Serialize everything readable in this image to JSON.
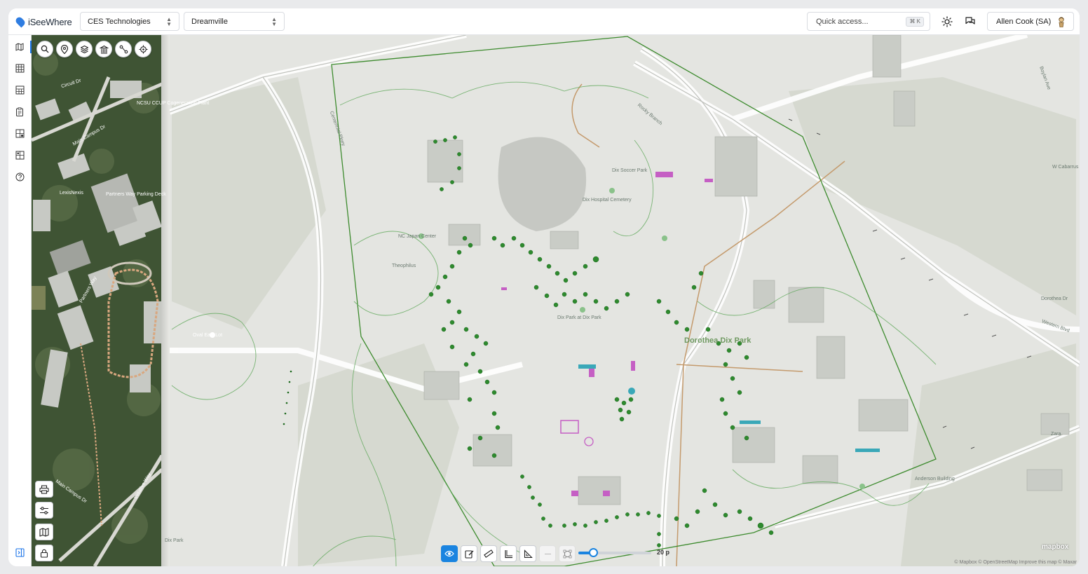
{
  "app": {
    "logo_text": "iSeeWhere",
    "brand_color": "#2f7de1"
  },
  "header": {
    "company_select": "CES Technologies",
    "site_select": "Dreamville",
    "quick_access_placeholder": "Quick access...",
    "quick_access_shortcut": "⌘ K",
    "theme_icon": "sun-icon",
    "chat_icon": "chat-icon",
    "user_name": "Allen Cook (SA)"
  },
  "sidebar": {
    "items": [
      {
        "icon": "map-icon",
        "active": true
      },
      {
        "icon": "grid-map-icon"
      },
      {
        "icon": "table-icon"
      },
      {
        "icon": "clipboard-icon"
      },
      {
        "icon": "layers-grid-icon"
      },
      {
        "icon": "grid-settings-icon"
      },
      {
        "icon": "help-icon"
      }
    ],
    "collapse_icon": "sidebar-toggle-icon"
  },
  "map": {
    "satellite_labels": [
      "Circuit Dr",
      "NCSU CCUP Cogeneration Plant",
      "Main Campus Dr",
      "LexisNexis",
      "Partners Way Parking Deck",
      "Partners Way",
      "Dix Park",
      "Main Campus Dr",
      "Initiative Way"
    ],
    "street_labels": [
      "Dix Soccer Park",
      "Dix Hospital Cemetery",
      "NC Japan Center",
      "Theophilus",
      "Dix Park at Dix Park",
      "Dorothea Dix Park",
      "Oval East Lot",
      "Centennial Pkwy",
      "Rocky Branch",
      "W Cabarrus",
      "Western Blvd",
      "Dorothea Dr",
      "Boylan Ave",
      "Anderson Building",
      "Zara"
    ],
    "park_label": "Dorothea Dix Park",
    "attribution": "© Mapbox © OpenStreetMap Improve this map © Maxar",
    "mapbox_logo": "mapbox",
    "boundary_color": "#3d8b2e",
    "tree_color": "#2e8a2e"
  },
  "map_tools": [
    "search-icon",
    "pin-icon",
    "layers-icon",
    "landmark-icon",
    "route-icon",
    "locate-icon"
  ],
  "left_tools": [
    "print-icon",
    "sliders-icon",
    "map-icon",
    "lock-icon"
  ],
  "bottom_tools": {
    "buttons": [
      "eye-icon",
      "edit-icon",
      "ruler-icon",
      "angle-icon",
      "triangle-ruler-icon",
      "line-icon",
      "polygon-icon"
    ],
    "slider_value": "20 p",
    "slider_fraction": 0.2
  }
}
